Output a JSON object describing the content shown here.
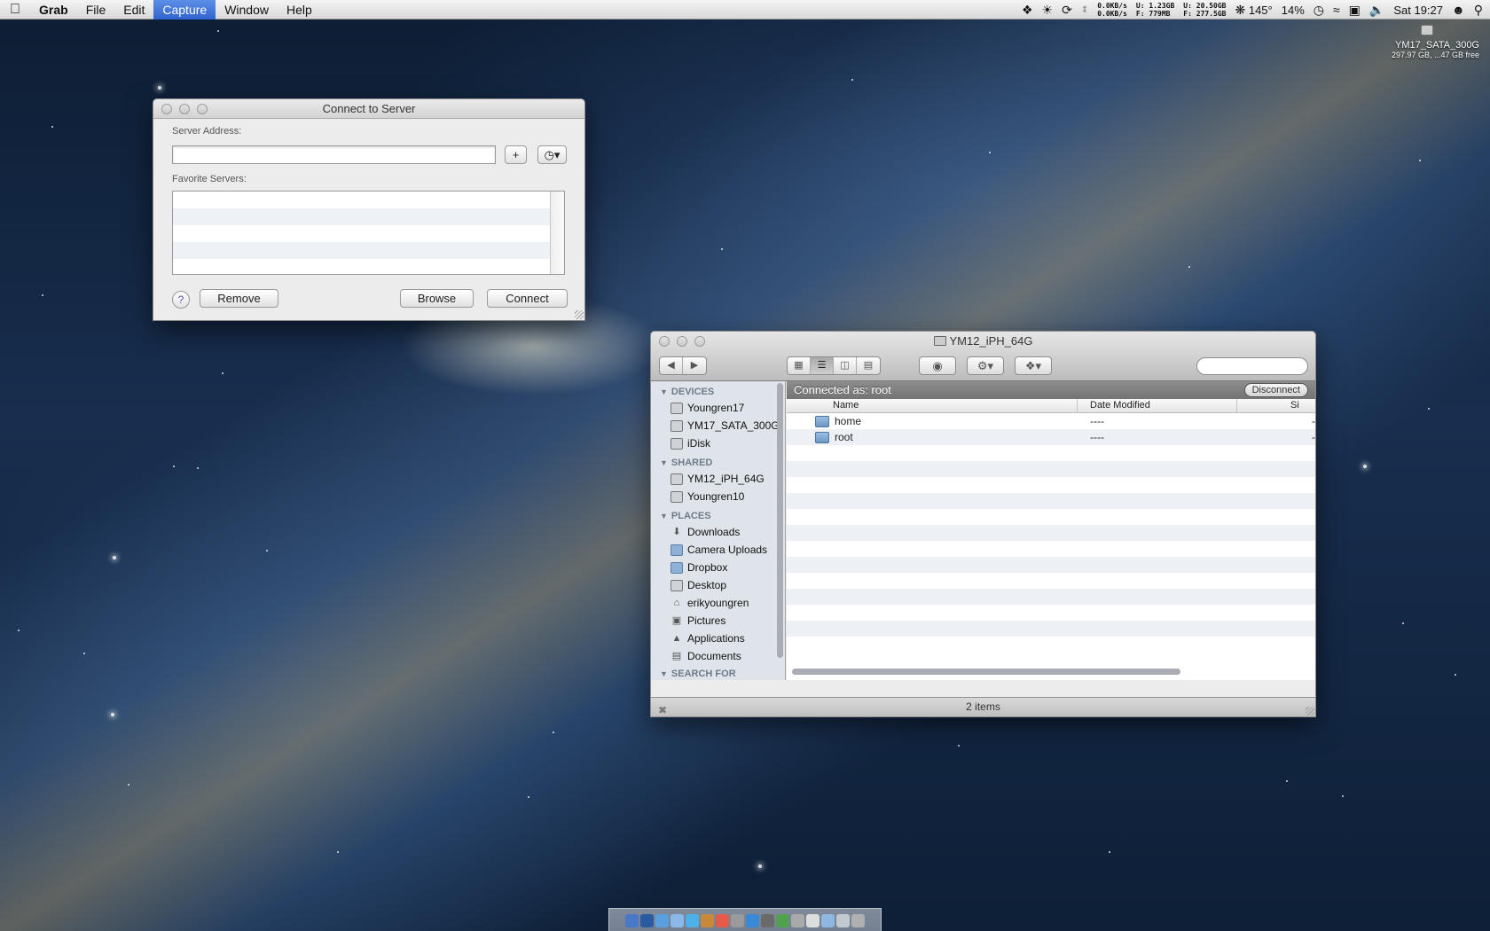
{
  "menubar": {
    "app": "Grab",
    "menus": [
      "File",
      "Edit",
      "Capture",
      "Window",
      "Help"
    ],
    "active_menu": "Capture",
    "net_up": "0.0KB/s",
    "net_down": "0.0KB/s",
    "mem_u_label": "U:",
    "mem_u": "1.23GB",
    "mem_f_label": "F:",
    "mem_f": "779MB",
    "disk_u_label": "U:",
    "disk_u": "20.50GB",
    "disk_f_label": "F:",
    "disk_f": "277.5GB",
    "fan": "145°",
    "battery": "14%",
    "clock": "Sat 19:27"
  },
  "desktop_drive": {
    "name": "YM17_SATA_300G",
    "info": "297.97 GB, ...47 GB free"
  },
  "connect_to_server": {
    "title": "Connect to Server",
    "server_address_label": "Server Address:",
    "server_address_value": "",
    "favorite_servers_label": "Favorite Servers:",
    "add_label": "+",
    "help_label": "?",
    "remove_label": "Remove",
    "browse_label": "Browse",
    "connect_label": "Connect"
  },
  "finder": {
    "title": "YM12_iPH_64G",
    "connected_as": "Connected as: root",
    "disconnect_label": "Disconnect",
    "sidebar": {
      "devices_label": "DEVICES",
      "devices": [
        {
          "label": "Youngren17",
          "icon": "computer-icon"
        },
        {
          "label": "YM17_SATA_300G",
          "icon": "hard-drive-icon"
        },
        {
          "label": "iDisk",
          "icon": "idisk-icon"
        }
      ],
      "shared_label": "SHARED",
      "shared": [
        {
          "label": "YM12_iPH_64G",
          "icon": "computer-icon"
        },
        {
          "label": "Youngren10",
          "icon": "computer-icon"
        }
      ],
      "places_label": "PLACES",
      "places": [
        {
          "label": "Downloads",
          "icon": "downloads-icon"
        },
        {
          "label": "Camera Uploads",
          "icon": "folder-icon"
        },
        {
          "label": "Dropbox",
          "icon": "folder-icon"
        },
        {
          "label": "Desktop",
          "icon": "desktop-icon"
        },
        {
          "label": "erikyoungren",
          "icon": "home-icon"
        },
        {
          "label": "Pictures",
          "icon": "pictures-icon"
        },
        {
          "label": "Applications",
          "icon": "applications-icon"
        },
        {
          "label": "Documents",
          "icon": "documents-icon"
        }
      ],
      "search_for_label": "SEARCH FOR"
    },
    "columns": {
      "name": "Name",
      "date_modified": "Date Modified",
      "size": "Si"
    },
    "files": [
      {
        "name": "home",
        "date": "----",
        "size": "-"
      },
      {
        "name": "root",
        "date": "----",
        "size": "-"
      }
    ],
    "status": "2 items"
  }
}
